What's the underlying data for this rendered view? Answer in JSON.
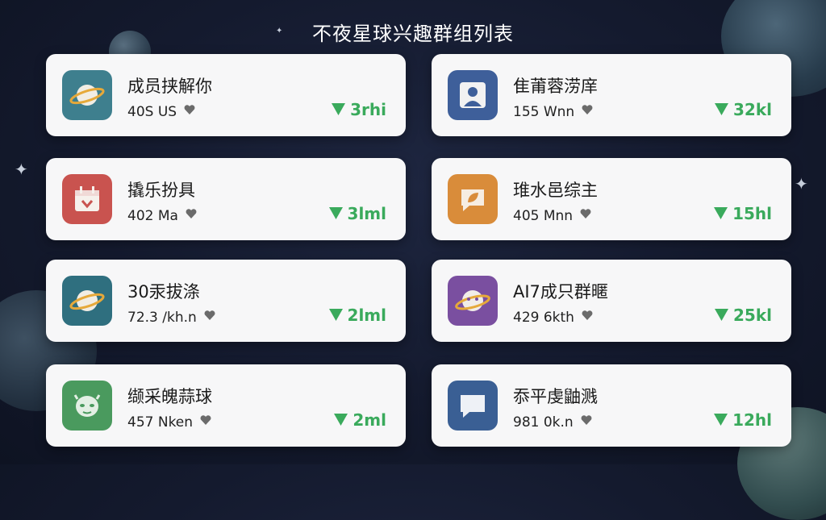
{
  "title": "不夜星球兴趣群组列表",
  "colors": {
    "trend": "#3aaa5c",
    "card_bg": "#f7f7f8"
  },
  "groups": [
    {
      "name": "成员挟解你",
      "meta": "40S US",
      "trend": "3rhi",
      "icon": "planet-icon",
      "icon_bg": "#3e7f8e"
    },
    {
      "name": "隹莆蓉涝庠",
      "meta": "155 Wnn",
      "trend": "32kl",
      "icon": "user-icon",
      "icon_bg": "#3e5f9a"
    },
    {
      "name": "撬乐扮具",
      "meta": "402 Ma",
      "trend": "3lml",
      "icon": "calendar-icon",
      "icon_bg": "#c9534f"
    },
    {
      "name": "琟水邑综主",
      "meta": "405 Mnn",
      "trend": "15hl",
      "icon": "leaf-chat-icon",
      "icon_bg": "#d98c3a"
    },
    {
      "name": "30汞拔涤",
      "meta": "72.3 /kh.n",
      "trend": "2lml",
      "icon": "planet-icon",
      "icon_bg": "#2f6f7f"
    },
    {
      "name": "AI7成只群暱",
      "meta": "429 6kth",
      "trend": "25kl",
      "icon": "planet-face-icon",
      "icon_bg": "#7a4fa0"
    },
    {
      "name": "缬采魄蒜球",
      "meta": "457 Nken",
      "trend": "2ml",
      "icon": "alien-icon",
      "icon_bg": "#4a9a5e"
    },
    {
      "name": "忝平虔鼬溅",
      "meta": "981 0k.n",
      "trend": "12hl",
      "icon": "chat-icon",
      "icon_bg": "#3a5f94"
    }
  ]
}
